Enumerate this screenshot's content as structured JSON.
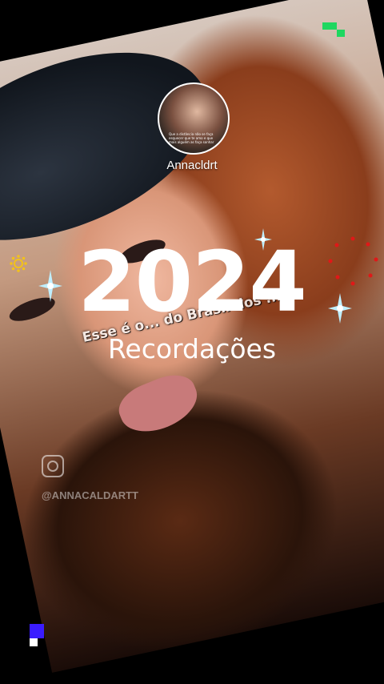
{
  "profile": {
    "username": "Annacldrt",
    "avatar_caption": "Que a distância não se faça esquecer que te amo e que mais alguém as faça sonhar"
  },
  "title": {
    "year": "2024",
    "subtitle": "Recordações"
  },
  "video_caption": "Esse é o... do Brasil dos ...",
  "watermark": {
    "icon": "instagram-icon",
    "handle": "@ANNACALDARTT"
  },
  "colors": {
    "sparkle": "#9fe4ff",
    "ring_dots": "#e01818",
    "sun": "#f2c21b",
    "pixel_green": "#1ed760",
    "pixel_purple": "#3a1cff"
  }
}
